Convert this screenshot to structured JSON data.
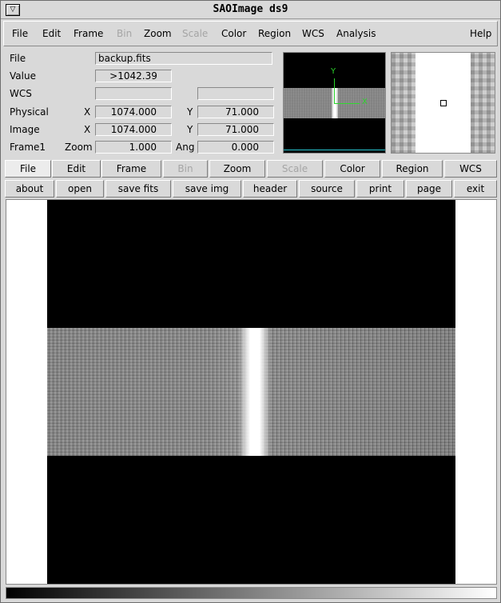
{
  "window": {
    "title": "SAOImage ds9",
    "system_button": "▽"
  },
  "menubar": {
    "items": [
      {
        "label": "File",
        "disabled": false
      },
      {
        "label": "Edit",
        "disabled": false
      },
      {
        "label": "Frame",
        "disabled": false
      },
      {
        "label": "Bin",
        "disabled": true
      },
      {
        "label": "Zoom",
        "disabled": false
      },
      {
        "label": "Scale",
        "disabled": true
      },
      {
        "label": "Color",
        "disabled": false
      },
      {
        "label": "Region",
        "disabled": false
      },
      {
        "label": "WCS",
        "disabled": false
      },
      {
        "label": "Analysis",
        "disabled": false
      },
      {
        "label": "Help",
        "disabled": false
      }
    ]
  },
  "info": {
    "file_label": "File",
    "file_value": "backup.fits",
    "value_label": "Value",
    "value_value": ">1042.39",
    "wcs_label": "WCS",
    "wcs_value_1": "",
    "wcs_value_2": "",
    "physical_label": "Physical",
    "physical_x_label": "X",
    "physical_x": "1074.000",
    "physical_y_label": "Y",
    "physical_y": "71.000",
    "image_label": "Image",
    "image_x_label": "X",
    "image_x": "1074.000",
    "image_y_label": "Y",
    "image_y": "71.000",
    "frame_label": "Frame1",
    "zoom_label": "Zoom",
    "zoom_value": "1.000",
    "angle_label": "Ang",
    "angle_value": "0.000"
  },
  "panner": {
    "axis_y": "Y",
    "axis_x": "X"
  },
  "button_bar_major": [
    {
      "label": "File",
      "active": true,
      "disabled": false
    },
    {
      "label": "Edit",
      "active": false,
      "disabled": false
    },
    {
      "label": "Frame",
      "active": false,
      "disabled": false
    },
    {
      "label": "Bin",
      "active": false,
      "disabled": true
    },
    {
      "label": "Zoom",
      "active": false,
      "disabled": false
    },
    {
      "label": "Scale",
      "active": false,
      "disabled": true
    },
    {
      "label": "Color",
      "active": false,
      "disabled": false
    },
    {
      "label": "Region",
      "active": false,
      "disabled": false
    },
    {
      "label": "WCS",
      "active": false,
      "disabled": false
    }
  ],
  "button_bar_minor": [
    {
      "label": "about"
    },
    {
      "label": "open"
    },
    {
      "label": "save fits"
    },
    {
      "label": "save img"
    },
    {
      "label": "header"
    },
    {
      "label": "source"
    },
    {
      "label": "print"
    },
    {
      "label": "page"
    },
    {
      "label": "exit"
    }
  ],
  "colors": {
    "background": "#d9d9d9",
    "panner_axes": "#2ad32a",
    "panner_bbox": "#27c4d0",
    "disabled_text": "#a5a5a5"
  },
  "colorbar": {
    "colormap": "grey"
  }
}
